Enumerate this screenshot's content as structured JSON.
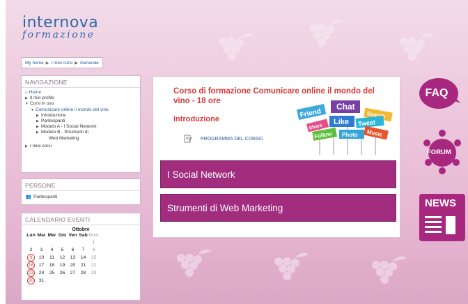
{
  "logo": {
    "main": "internova",
    "sub": "formazione"
  },
  "breadcrumb": {
    "items": [
      "My home",
      "I miei corsi",
      "Generale"
    ]
  },
  "navigation": {
    "title": "NAVIGAZIONE",
    "items": [
      "Home",
      "Il mio profilo",
      "Corsi in uso",
      "Comunicare online il mondo del vino",
      "Introduzione",
      "Partecipanti",
      "Modulo A - I Social Network",
      "Modulo B - Strumenti di",
      "Web Marketing",
      "I miei corsi"
    ]
  },
  "people": {
    "title": "PERSONE",
    "participants": "Partecipanti"
  },
  "calendar": {
    "title": "CALENDARIO EVENTI",
    "month": "Ottobre",
    "weekdays": [
      "Lun",
      "Mar",
      "Mer",
      "Gio",
      "Ven",
      "Sab",
      "Dom"
    ],
    "rows": [
      [
        "",
        "",
        "",
        "",
        "",
        "",
        "1"
      ],
      [
        "2",
        "3",
        "4",
        "5",
        "6",
        "7",
        "8"
      ],
      [
        "9",
        "10",
        "11",
        "12",
        "13",
        "14",
        "15"
      ],
      [
        "16",
        "17",
        "18",
        "19",
        "20",
        "21",
        "22"
      ],
      [
        "23",
        "24",
        "25",
        "26",
        "27",
        "28",
        "29"
      ],
      [
        "30",
        "31",
        "",
        "",
        "",
        "",
        ""
      ]
    ],
    "event_days": [
      "9",
      "16",
      "23",
      "30"
    ],
    "event_color": "#d93b3b"
  },
  "main": {
    "course_title": "Corso di formazione Comunicare online il mondo del vino - 18 ore",
    "intro": "Introduzione",
    "program_link": "PROGRAMMA DEL CORSO",
    "social_words": [
      "Friend",
      "Chat",
      "Like",
      "Tweet",
      "Share",
      "Follow",
      "Photo",
      "Music",
      "Search"
    ],
    "modules": [
      "I Social Network",
      "Strumenti di Web Marketing"
    ]
  },
  "side": {
    "faq": "FAQ",
    "forum": "FORUM",
    "news": "NEWS"
  },
  "colors": {
    "accent": "#a22d7e",
    "title_red": "#d63a3a",
    "link_blue": "#2d5a9a",
    "background": "#e9bfd8"
  }
}
